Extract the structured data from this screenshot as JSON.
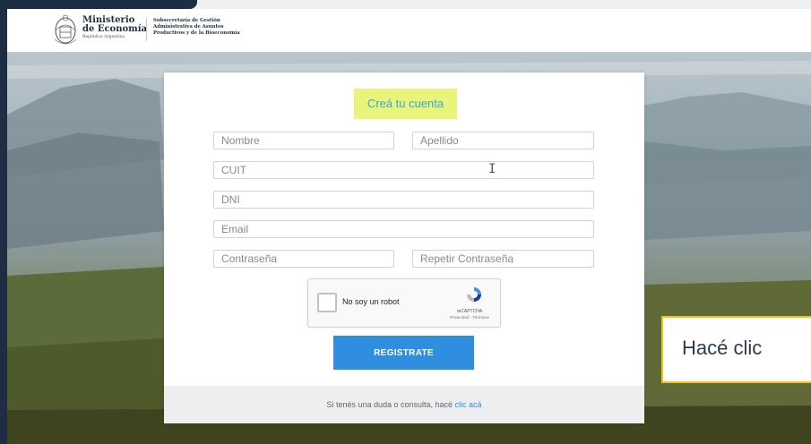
{
  "header": {
    "ministry_line1": "Ministerio",
    "ministry_line2": "de Economía",
    "ministry_line3": "República Argentina",
    "subsecretaria_line1": "Subsecretaría de Gestión",
    "subsecretaria_line2": "Administrativa de Asuntos",
    "subsecretaria_line3": "Productivos y de la Bioeconomía"
  },
  "form": {
    "title": "Creá tu cuenta",
    "nombre_placeholder": "Nombre",
    "apellido_placeholder": "Apellido",
    "cuit_placeholder": "CUIT",
    "dni_placeholder": "DNI",
    "email_placeholder": "Email",
    "password_placeholder": "Contraseña",
    "repeat_password_placeholder": "Repetir Contraseña",
    "captcha_label": "No soy un robot",
    "captcha_brand": "reCAPTCHA",
    "captcha_terms": "Privacidad - Términos",
    "submit_label": "REGISTRATE",
    "footer_text": "Si tenés una duda o consulta, hacé ",
    "footer_link": "clic acá"
  },
  "caption": {
    "text": "Hacé clic"
  },
  "colors": {
    "accent": "#2f8ee0",
    "title_highlight": "#e8f47a",
    "navy": "#1f2d44",
    "caption_border": "#f0c419"
  }
}
